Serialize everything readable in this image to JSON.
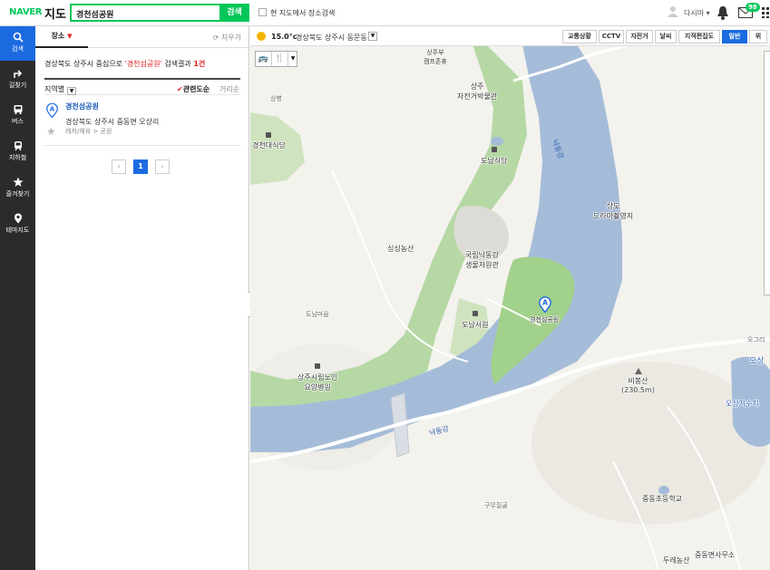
{
  "header": {
    "logo": "NAVER",
    "service": "지도",
    "search_value": "경천섬공원",
    "search_button": "검색",
    "here_search_label": "현 지도에서 장소검색",
    "user_name": "다시마 ▾",
    "mail_count": "98"
  },
  "nav": {
    "items": [
      {
        "label": "검색",
        "icon": "search-icon"
      },
      {
        "label": "길찾기",
        "icon": "directions-icon"
      },
      {
        "label": "버스",
        "icon": "bus-icon"
      },
      {
        "label": "지하철",
        "icon": "subway-icon"
      },
      {
        "label": "즐겨찾기",
        "icon": "star-icon"
      },
      {
        "label": "테마지도",
        "icon": "pin-icon"
      }
    ]
  },
  "panel": {
    "tab_label": "장소",
    "clear_label": "⟳ 지우기",
    "summary_prefix": "경상북도 상주시 중심으로 ",
    "summary_query": "'경천섬공원'",
    "summary_mid": " 검색결과 ",
    "summary_count": "1건",
    "filter_region": "지역별",
    "sort_relevance": "관련도순",
    "sort_distance": "거리순",
    "result": {
      "marker": "A",
      "name": "경천섬공원",
      "address": "경상북도 상주시 중동면 오상리",
      "category": "레저/체육 > 공원"
    },
    "pagination": {
      "prev": "‹",
      "current": "1",
      "next": "›"
    }
  },
  "map": {
    "weather": {
      "temp": "15.0°c",
      "location": "경상북도 상주시 동문동"
    },
    "buttons": [
      "교통상황",
      "CCTV",
      "자전거",
      "날씨",
      "지적편집도",
      "일반",
      "위"
    ],
    "active_button": "일반",
    "labels": {
      "camp": "상주부\n캠프존휴",
      "museum": "상주\n자전거박물관",
      "sangbyeong": "상병",
      "gyeongcheondae": "경천대식당",
      "donamsikdang": "도남식당",
      "river_top": "낙동강",
      "sangdo": "상도\n드라마촬영지",
      "singsing": "싱싱농산",
      "arboretum": "국립낙동강\n생물자원관",
      "donam_village": "도남마을",
      "donam_seowon": "도남서원",
      "park": "경천섬공원",
      "nursing": "상주시립노인\n요양병원",
      "river_bottom": "낙동강",
      "bibongsan": "비봉산\n(230.5m)",
      "osang": "오상",
      "ogeuri": "오그리",
      "reservoir": "오상저수지",
      "jungdong_school": "중동초등학교",
      "gumujil": "구무질골",
      "dureong": "두레농산",
      "office": "중동면사무소"
    },
    "park_marker": "A"
  }
}
